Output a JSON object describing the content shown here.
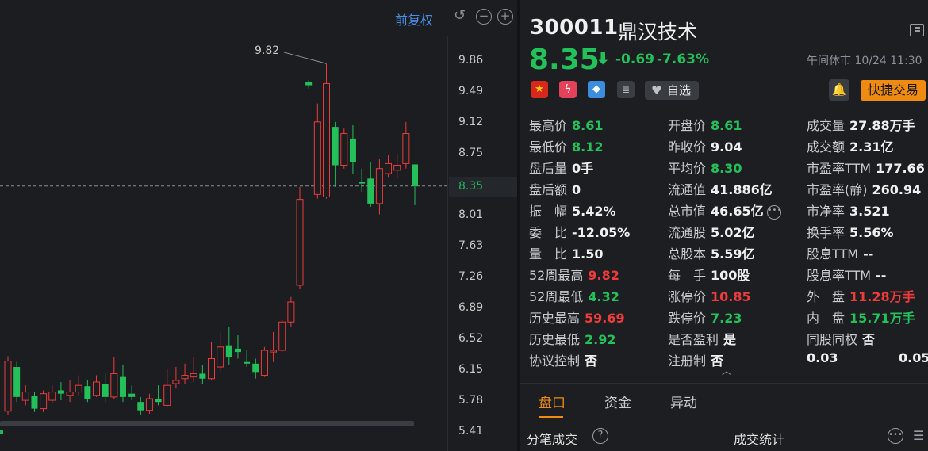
{
  "toolbar": {
    "fq_label": "前复权",
    "undo_icon": "undo-icon",
    "zoom_out_icon": "zoom-out-icon",
    "zoom_in_icon": "zoom-in-icon"
  },
  "chart_data": {
    "type": "candlestick",
    "y_ticks": [
      "9.86",
      "9.49",
      "9.12",
      "8.75",
      "8.38",
      "8.01",
      "7.63",
      "7.26",
      "6.89",
      "6.52",
      "6.15",
      "5.78",
      "5.41"
    ],
    "current_price_label": "8.35",
    "high_marker_label": "9.82",
    "ylim": [
      5.41,
      9.86
    ],
    "up_color": "#ee3b3b",
    "down_color": "#24c05a",
    "candles": [
      {
        "o": 5.65,
        "c": 6.25,
        "h": 6.31,
        "l": 5.6
      },
      {
        "o": 6.18,
        "c": 5.82,
        "h": 6.24,
        "l": 5.76
      },
      {
        "o": 5.78,
        "c": 5.88,
        "h": 5.96,
        "l": 5.72
      },
      {
        "o": 5.83,
        "c": 5.68,
        "h": 5.88,
        "l": 5.64
      },
      {
        "o": 5.68,
        "c": 5.86,
        "h": 5.9,
        "l": 5.64
      },
      {
        "o": 5.78,
        "c": 5.88,
        "h": 5.96,
        "l": 5.74
      },
      {
        "o": 5.9,
        "c": 5.86,
        "h": 6.0,
        "l": 5.78
      },
      {
        "o": 5.84,
        "c": 5.88,
        "h": 6.02,
        "l": 5.76
      },
      {
        "o": 5.88,
        "c": 5.96,
        "h": 6.08,
        "l": 5.84
      },
      {
        "o": 5.95,
        "c": 5.8,
        "h": 6.02,
        "l": 5.76
      },
      {
        "o": 5.84,
        "c": 6.0,
        "h": 6.08,
        "l": 5.82
      },
      {
        "o": 5.98,
        "c": 5.82,
        "h": 6.1,
        "l": 5.76
      },
      {
        "o": 5.82,
        "c": 6.1,
        "h": 6.3,
        "l": 5.8
      },
      {
        "o": 6.06,
        "c": 5.82,
        "h": 6.2,
        "l": 5.76
      },
      {
        "o": 5.86,
        "c": 5.82,
        "h": 5.96,
        "l": 5.78
      },
      {
        "o": 5.76,
        "c": 5.66,
        "h": 5.82,
        "l": 5.6
      },
      {
        "o": 5.66,
        "c": 5.8,
        "h": 5.86,
        "l": 5.62
      },
      {
        "o": 5.8,
        "c": 5.76,
        "h": 5.96,
        "l": 5.72
      },
      {
        "o": 5.72,
        "c": 5.96,
        "h": 6.16,
        "l": 5.7
      },
      {
        "o": 5.98,
        "c": 6.02,
        "h": 6.18,
        "l": 5.92
      },
      {
        "o": 6.04,
        "c": 6.08,
        "h": 6.22,
        "l": 5.98
      },
      {
        "o": 6.06,
        "c": 6.1,
        "h": 6.3,
        "l": 6.0
      },
      {
        "o": 6.1,
        "c": 6.04,
        "h": 6.2,
        "l": 5.98
      },
      {
        "o": 6.04,
        "c": 6.28,
        "h": 6.48,
        "l": 6.02
      },
      {
        "o": 6.18,
        "c": 6.42,
        "h": 6.6,
        "l": 6.12
      },
      {
        "o": 6.44,
        "c": 6.3,
        "h": 6.66,
        "l": 6.2
      },
      {
        "o": 6.4,
        "c": 6.36,
        "h": 6.56,
        "l": 6.28
      },
      {
        "o": 6.24,
        "c": 6.22,
        "h": 6.38,
        "l": 6.18
      },
      {
        "o": 6.22,
        "c": 6.12,
        "h": 6.28,
        "l": 6.04
      },
      {
        "o": 6.08,
        "c": 6.38,
        "h": 6.42,
        "l": 6.06
      },
      {
        "o": 6.36,
        "c": 6.38,
        "h": 6.6,
        "l": 6.24
      },
      {
        "o": 6.38,
        "c": 6.72,
        "h": 6.74,
        "l": 6.36
      },
      {
        "o": 6.72,
        "c": 6.96,
        "h": 7.02,
        "l": 6.66
      },
      {
        "o": 7.16,
        "c": 8.19,
        "h": 8.34,
        "l": 7.12
      },
      {
        "o": 9.6,
        "c": 9.56,
        "h": 9.62,
        "l": 9.52
      },
      {
        "o": 8.25,
        "c": 9.12,
        "h": 9.34,
        "l": 8.2
      },
      {
        "o": 8.22,
        "c": 9.58,
        "h": 9.82,
        "l": 8.2
      },
      {
        "o": 9.06,
        "c": 8.6,
        "h": 9.12,
        "l": 8.34
      },
      {
        "o": 8.6,
        "c": 8.98,
        "h": 9.04,
        "l": 8.56
      },
      {
        "o": 8.92,
        "c": 8.64,
        "h": 9.08,
        "l": 8.5
      },
      {
        "o": 8.4,
        "c": 8.38,
        "h": 8.56,
        "l": 8.28
      },
      {
        "o": 8.44,
        "c": 8.14,
        "h": 8.64,
        "l": 8.1
      },
      {
        "o": 8.14,
        "c": 8.56,
        "h": 8.68,
        "l": 8.01
      },
      {
        "o": 8.5,
        "c": 8.62,
        "h": 8.72,
        "l": 8.46
      },
      {
        "o": 8.54,
        "c": 8.6,
        "h": 8.74,
        "l": 8.44
      },
      {
        "o": 8.62,
        "c": 8.98,
        "h": 9.12,
        "l": 8.56
      },
      {
        "o": 8.61,
        "c": 8.35,
        "h": 8.61,
        "l": 8.12
      }
    ]
  },
  "stock": {
    "code": "300011",
    "name": "鼎汉技术",
    "price": "8.35",
    "arrow_icon": "arrow-down-icon",
    "change": "-0.69",
    "change_pct": "-7.63%",
    "status": "午间休市 10/24 11:30"
  },
  "icons": {
    "flag": "china-flag-icon",
    "flash": "flash-icon",
    "tag": "tag-icon",
    "note": "note-icon",
    "bell": "bell-icon",
    "heart": "heart-icon"
  },
  "actions": {
    "favorite": "自选",
    "quick_trade": "快捷交易"
  },
  "quote": {
    "col1": [
      {
        "label": "最高价",
        "value": "8.61",
        "color": "g"
      },
      {
        "label": "最低价",
        "value": "8.12",
        "color": "g"
      },
      {
        "label": "盘后量",
        "value": "0手",
        "color": "w"
      },
      {
        "label": "盘后额",
        "value": "0",
        "color": "w"
      },
      {
        "label": "振　幅",
        "value": "5.42%",
        "color": "w"
      },
      {
        "label": "委　比",
        "value": "-12.05%",
        "color": "w"
      },
      {
        "label": "量　比",
        "value": "1.50",
        "color": "w"
      },
      {
        "label": "52周最高",
        "value": "9.82",
        "color": "r"
      },
      {
        "label": "52周最低",
        "value": "4.32",
        "color": "g"
      },
      {
        "label": "历史最高",
        "value": "59.69",
        "color": "r"
      },
      {
        "label": "历史最低",
        "value": "2.92",
        "color": "g"
      },
      {
        "label": "协议控制",
        "value": "否",
        "color": "w"
      }
    ],
    "col2": [
      {
        "label": "开盘价",
        "value": "8.61",
        "color": "g"
      },
      {
        "label": "昨收价",
        "value": "9.04",
        "color": "w"
      },
      {
        "label": "平均价",
        "value": "8.30",
        "color": "g"
      },
      {
        "label": "流通值",
        "value": "41.886亿",
        "color": "w"
      },
      {
        "label": "总市值",
        "value": "46.65亿",
        "color": "w"
      },
      {
        "label": "流通股",
        "value": "5.02亿",
        "color": "w"
      },
      {
        "label": "总股本",
        "value": "5.59亿",
        "color": "w"
      },
      {
        "label": "每　手",
        "value": "100股",
        "color": "w"
      },
      {
        "label": "涨停价",
        "value": "10.85",
        "color": "r"
      },
      {
        "label": "跌停价",
        "value": "7.23",
        "color": "g"
      },
      {
        "label": "是否盈利",
        "value": "是",
        "color": "w"
      },
      {
        "label": "注册制",
        "value": "否",
        "color": "w"
      }
    ],
    "col3": [
      {
        "label": "成交量",
        "value": "27.88万手",
        "color": "w"
      },
      {
        "label": "成交额",
        "value": "2.31亿",
        "color": "w"
      },
      {
        "label": "市盈率TTM",
        "value": "177.66",
        "color": "w"
      },
      {
        "label": "市盈率(静)",
        "value": "260.94",
        "color": "w"
      },
      {
        "label": "市净率",
        "value": "3.521",
        "color": "w"
      },
      {
        "label": "换手率",
        "value": "5.56%",
        "color": "w"
      },
      {
        "label": "股息TTM",
        "value": "--",
        "color": "w"
      },
      {
        "label": "股息率TTM",
        "value": "--",
        "color": "w"
      },
      {
        "label": "外　盘",
        "value": "11.28万手",
        "color": "r"
      },
      {
        "label": "内　盘",
        "value": "15.71万手",
        "color": "g"
      },
      {
        "label": "同股同权",
        "value": "否",
        "color": "w"
      },
      {
        "label": "",
        "value": "0.03",
        "color": "w"
      }
    ],
    "extra_value": "0.05"
  },
  "tabs": [
    "盘口",
    "资金",
    "异动"
  ],
  "bottom": {
    "trades_label": "分笔成交",
    "stats_label": "成交统计"
  }
}
